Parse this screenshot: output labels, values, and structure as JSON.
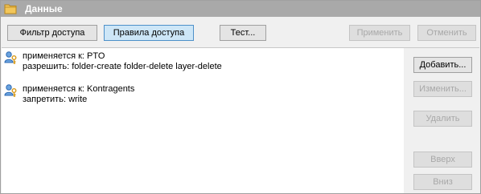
{
  "window": {
    "title": "Данные"
  },
  "toolbar": {
    "filter_label": "Фильтр доступа",
    "rules_label": "Правила доступа",
    "test_label": "Тест...",
    "apply_label": "Применить",
    "cancel_label": "Отменить"
  },
  "rules": [
    {
      "applies_label": "применяется к:",
      "applies_to": "PTO",
      "permission_label": "разрешить:",
      "permissions": "folder-create folder-delete layer-delete"
    },
    {
      "applies_label": "применяется к:",
      "applies_to": "Kontragents",
      "permission_label": "запретить:",
      "permissions": "write"
    }
  ],
  "actions": {
    "add_label": "Добавить...",
    "edit_label": "Изменить...",
    "delete_label": "Удалить",
    "up_label": "Вверх",
    "down_label": "Вниз"
  },
  "colors": {
    "titlebar": "#a9a9a9",
    "active_tab": "#cde6f7",
    "active_tab_border": "#4d90c9",
    "folder": "#e8b84a",
    "user_icon": "#3a79c4",
    "key_icon": "#e0a020"
  }
}
